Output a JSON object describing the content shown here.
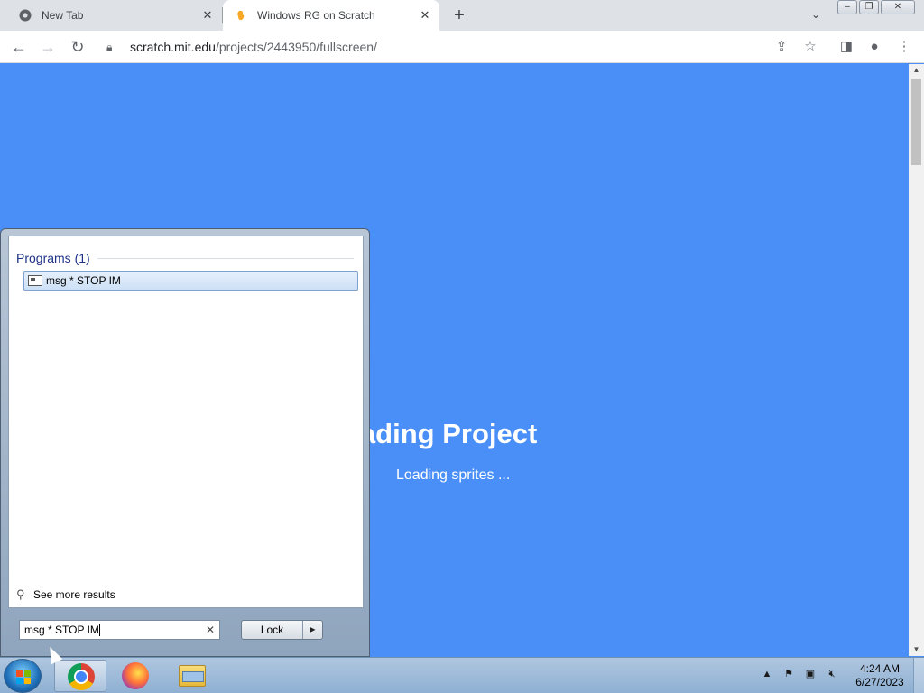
{
  "browser": {
    "tabs": [
      {
        "title": "New Tab",
        "icon": "chrome-icon",
        "active": false
      },
      {
        "title": "Windows RG on Scratch",
        "icon": "scratch-icon",
        "active": true
      }
    ],
    "address": {
      "domain": "scratch.mit.edu",
      "path": "/projects/2443950/fullscreen/"
    }
  },
  "page": {
    "background": "#4a8ff7",
    "loading_title": "oading Project",
    "loading_sub": "Loading sprites ..."
  },
  "start_menu": {
    "section_heading": "Programs (1)",
    "result_label": "msg * STOP IM",
    "see_more": "See more results",
    "search_value": "msg * STOP IM",
    "lock_label": "Lock"
  },
  "taskbar": {
    "apps": [
      "chrome-icon",
      "firefox-icon",
      "file-explorer-icon"
    ],
    "clock_time": "4:24 AM",
    "clock_date": "6/27/2023"
  }
}
